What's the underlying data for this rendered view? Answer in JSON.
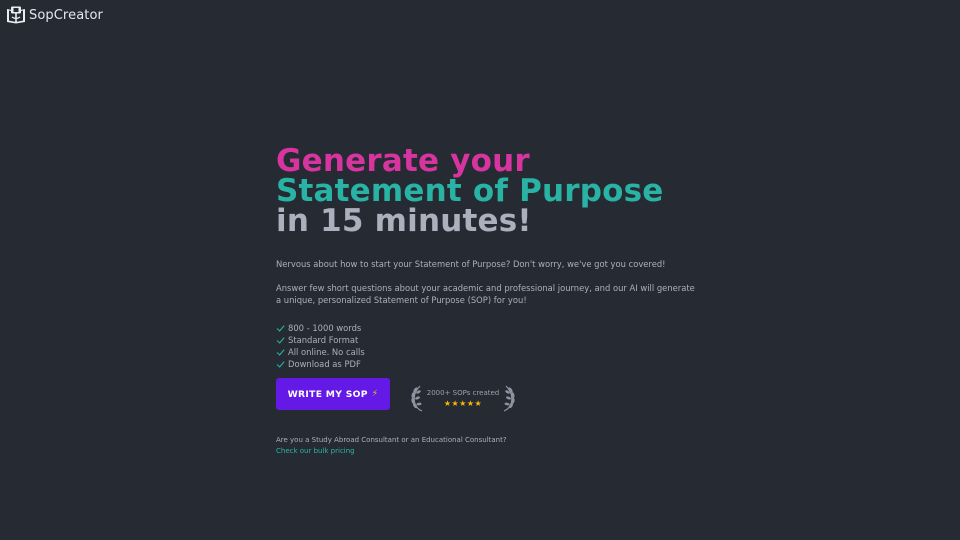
{
  "brand": {
    "name": "SopCreator"
  },
  "hero": {
    "headline_line1": "Generate your",
    "headline_line2": "Statement of Purpose",
    "headline_line3": "in 15 minutes!",
    "paragraph1": "Nervous about how to start your Statement of Purpose? Don't worry, we've got you covered!",
    "paragraph2": "Answer few short questions about your academic and professional journey, and our AI will generate a unique, personalized Statement of Purpose (SOP) for you!",
    "features": [
      "800 - 1000 words",
      "Standard Format",
      "All online. No calls",
      "Download as PDF"
    ]
  },
  "cta": {
    "label": "WRITE MY SOP",
    "icon": "lightning-icon",
    "icon_glyph": "⚡"
  },
  "badge": {
    "text": "2000+ SOPs created",
    "stars": "★★★★★",
    "rating": 5
  },
  "consultant": {
    "question": "Are you a Study Abroad Consultant or an Educational Consultant?",
    "link_text": "Check our bulk pricing"
  },
  "colors": {
    "background": "#262a33",
    "headline_pink": "#d6359f",
    "headline_teal": "#29b3a4",
    "cta_purple": "#6419e6",
    "link_teal": "#2bb6a6",
    "star_gold": "#f5b900"
  }
}
